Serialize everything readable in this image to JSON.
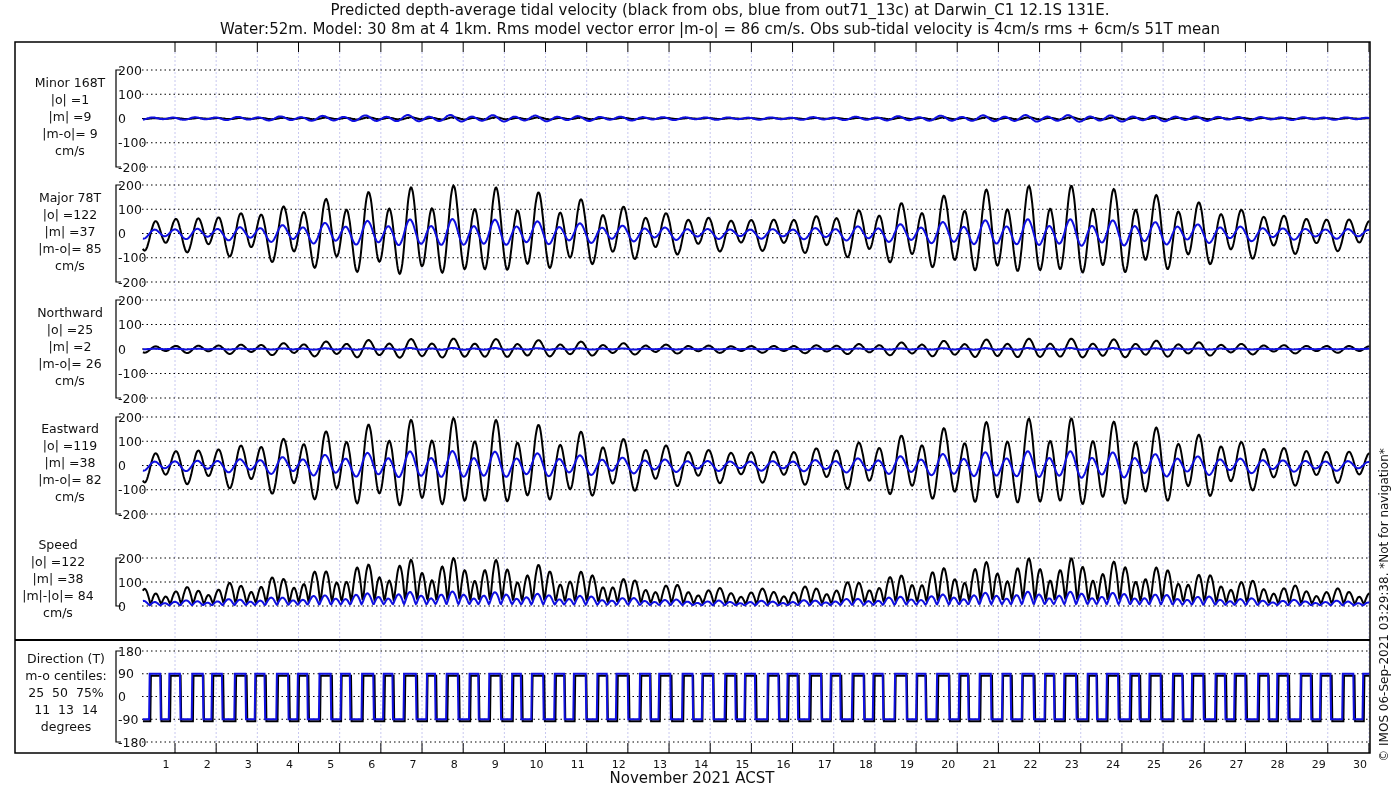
{
  "title": [
    "Predicted depth-average tidal velocity (black from obs, blue from out71_13c) at Darwin_C1 12.1S 131E.",
    "Water:52m. Model: 30 8m at 4 1km. Rms model vector error |m-o| = 86 cm/s. Obs sub-tidal velocity is 4cm/s rms + 6cm/s 51T mean"
  ],
  "panels": [
    {
      "kind": "velocity",
      "label": [
        "Minor 168T",
        "|o| =1",
        "|m| =9",
        "|m-o|= 9",
        "cm/s"
      ],
      "yticks": [
        "200",
        "100",
        "0",
        "-100",
        "-200"
      ]
    },
    {
      "kind": "velocity",
      "label": [
        "Major 78T",
        "|o| =122",
        "|m| =37",
        "|m-o|= 85",
        "cm/s"
      ],
      "yticks": [
        "200",
        "100",
        "0",
        "-100",
        "-200"
      ]
    },
    {
      "kind": "velocity",
      "label": [
        "Northward",
        "|o| =25",
        "|m| =2",
        "|m-o|= 26",
        "cm/s"
      ],
      "yticks": [
        "200",
        "100",
        "0",
        "-100",
        "-200"
      ]
    },
    {
      "kind": "velocity",
      "label": [
        "Eastward",
        "|o| =119",
        "|m| =38",
        "|m-o|= 82",
        "cm/s"
      ],
      "yticks": [
        "200",
        "100",
        "0",
        "-100",
        "-200"
      ]
    },
    {
      "kind": "speed",
      "label": [
        "Speed",
        "|o| =122",
        "|m| =38",
        "|m|-|o|= 84",
        "cm/s"
      ],
      "yticks": [
        "200",
        "100",
        "0"
      ]
    },
    {
      "kind": "direction",
      "label": [
        "Direction (T)",
        "m-o centiles:",
        "25  50  75%",
        "11  13  14",
        "degrees"
      ],
      "yticks": [
        "180",
        "90",
        "0",
        "-90",
        "-180"
      ]
    }
  ],
  "xaxis": {
    "ticks": [
      "1",
      "2",
      "3",
      "4",
      "5",
      "6",
      "7",
      "8",
      "9",
      "10",
      "11",
      "12",
      "13",
      "14",
      "15",
      "16",
      "17",
      "18",
      "19",
      "20",
      "21",
      "22",
      "23",
      "24",
      "25",
      "26",
      "27",
      "28",
      "29",
      "30"
    ],
    "label": "November 2021 ACST"
  },
  "notice": "© IMOS 06-Sep-2021 03:29:38. *Not for navigation*"
}
